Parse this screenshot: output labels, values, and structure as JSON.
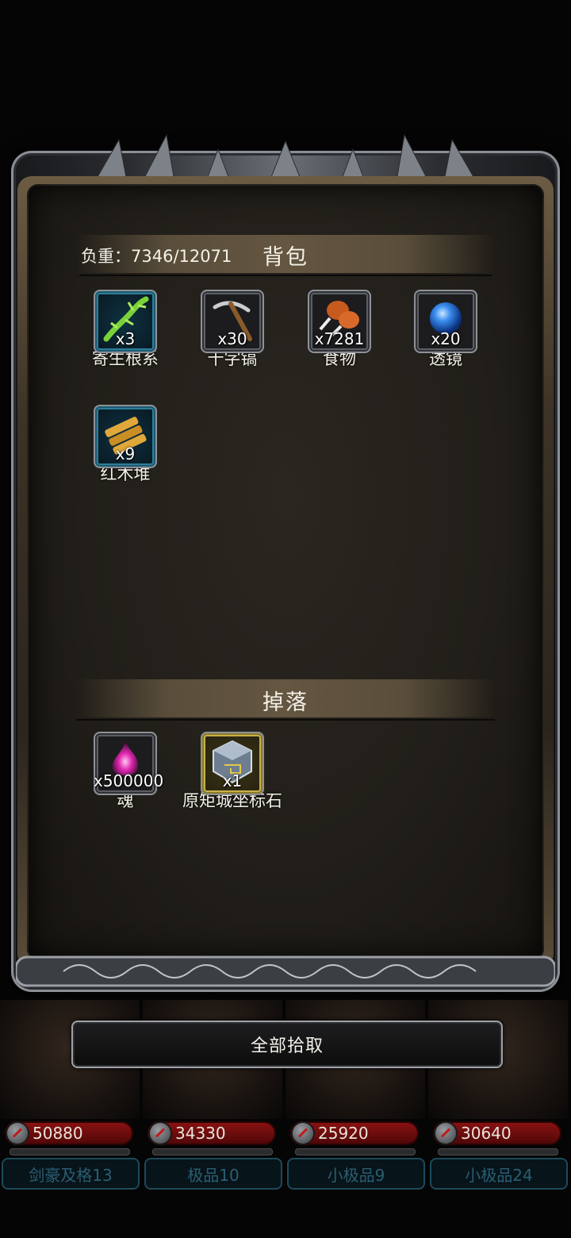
{
  "inventory": {
    "weight_label": "负重：7346/12071",
    "title": "背包",
    "items": [
      {
        "qty": "x3",
        "name": "寄生根系",
        "icon": "parasitic-root-icon",
        "rarity": "blue"
      },
      {
        "qty": "x30",
        "name": "十字镐",
        "icon": "pickaxe-icon",
        "rarity": "common"
      },
      {
        "qty": "x7281",
        "name": "食物",
        "icon": "meat-icon",
        "rarity": "common"
      },
      {
        "qty": "x20",
        "name": "透镜",
        "icon": "lens-orb-icon",
        "rarity": "common"
      },
      {
        "qty": "x9",
        "name": "红木堆",
        "icon": "wood-pile-icon",
        "rarity": "blue"
      }
    ]
  },
  "drops": {
    "title": "掉落",
    "items": [
      {
        "qty": "x500000",
        "name": "魂",
        "icon": "soul-flame-icon",
        "rarity": "common"
      },
      {
        "qty": "x1",
        "name": "原矩城坐标石",
        "icon": "coordinate-stone-icon",
        "rarity": "gold"
      }
    ]
  },
  "pick_all_button": "全部拾取",
  "heroes": [
    {
      "hp": "50880",
      "label": "剑豪及格13"
    },
    {
      "hp": "34330",
      "label": "极品10"
    },
    {
      "hp": "25920",
      "label": "小极品9"
    },
    {
      "hp": "30640",
      "label": "小极品24"
    }
  ],
  "colors": {
    "panel_bg": "#221f1a",
    "section_band": "#5a4e3a",
    "hp_bar": "#8c1212",
    "blue_rarity": "#2e7d98",
    "gold_rarity": "#c8b048"
  }
}
